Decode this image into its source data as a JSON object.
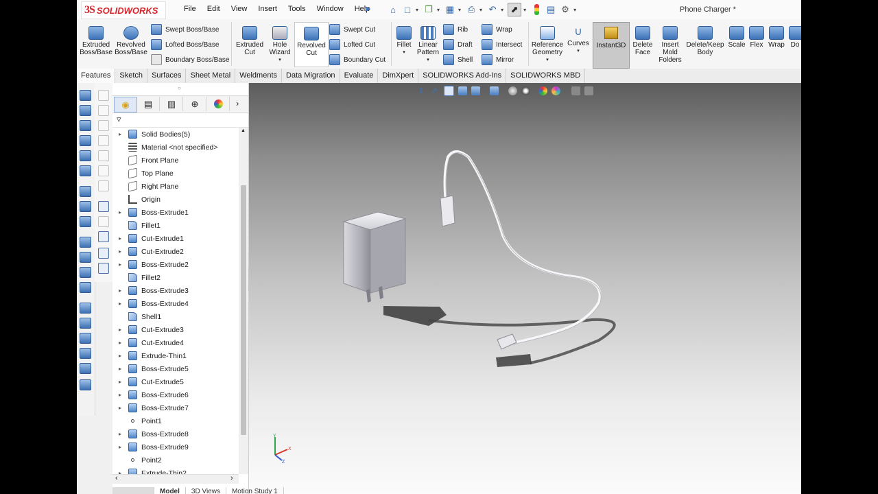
{
  "window": {
    "document_title": "Phone Charger *",
    "brand": "SOLIDWORKS",
    "brand_mark": "3S"
  },
  "menu": [
    "File",
    "Edit",
    "View",
    "Insert",
    "Tools",
    "Window",
    "Help"
  ],
  "quick_access_icons": [
    "home-icon",
    "new-document-icon",
    "open-icon",
    "save-icon",
    "print-icon",
    "undo-icon",
    "select-icon",
    "rebuild-icon",
    "file-properties-icon",
    "options-icon"
  ],
  "commands": {
    "extruded_boss": "Extruded\nBoss/Base",
    "revolved_boss": "Revolved\nBoss/Base",
    "swept_boss": "Swept Boss/Base",
    "lofted_boss": "Lofted Boss/Base",
    "boundary_boss": "Boundary Boss/Base",
    "extruded_cut": "Extruded\nCut",
    "hole_wizard": "Hole\nWizard",
    "revolved_cut": "Revolved\nCut",
    "swept_cut": "Swept Cut",
    "lofted_cut": "Lofted Cut",
    "boundary_cut": "Boundary Cut",
    "fillet": "Fillet",
    "linear_pattern": "Linear\nPattern",
    "rib": "Rib",
    "draft": "Draft",
    "shell": "Shell",
    "wrap": "Wrap",
    "intersect": "Intersect",
    "mirror": "Mirror",
    "reference_geometry": "Reference\nGeometry",
    "curves": "Curves",
    "instant3d": "Instant3D",
    "delete_face": "Delete\nFace",
    "insert_mold_folders": "Insert\nMold\nFolders",
    "delete_keep_body": "Delete/Keep\nBody",
    "scale": "Scale",
    "flex": "Flex",
    "wrap2": "Wrap",
    "do": "Do"
  },
  "tabs": [
    "Features",
    "Sketch",
    "Surfaces",
    "Sheet Metal",
    "Weldments",
    "Data Migration",
    "Evaluate",
    "DimXpert",
    "SOLIDWORKS Add-Ins",
    "SOLIDWORKS MBD"
  ],
  "feature_tree": [
    {
      "label": "Solid Bodies(5)",
      "icon": "solid-bodies",
      "expandable": true
    },
    {
      "label": "Material <not specified>",
      "icon": "material",
      "expandable": false
    },
    {
      "label": "Front Plane",
      "icon": "plane",
      "expandable": false
    },
    {
      "label": "Top Plane",
      "icon": "plane",
      "expandable": false
    },
    {
      "label": "Right Plane",
      "icon": "plane",
      "expandable": false
    },
    {
      "label": "Origin",
      "icon": "origin",
      "expandable": false
    },
    {
      "label": "Boss-Extrude1",
      "icon": "feature",
      "expandable": true
    },
    {
      "label": "Fillet1",
      "icon": "fillet",
      "expandable": false
    },
    {
      "label": "Cut-Extrude1",
      "icon": "feature",
      "expandable": true
    },
    {
      "label": "Cut-Extrude2",
      "icon": "feature",
      "expandable": true
    },
    {
      "label": "Boss-Extrude2",
      "icon": "feature",
      "expandable": true
    },
    {
      "label": "Fillet2",
      "icon": "fillet",
      "expandable": false
    },
    {
      "label": "Boss-Extrude3",
      "icon": "feature",
      "expandable": true
    },
    {
      "label": "Boss-Extrude4",
      "icon": "feature",
      "expandable": true
    },
    {
      "label": "Shell1",
      "icon": "fillet",
      "expandable": false
    },
    {
      "label": "Cut-Extrude3",
      "icon": "feature",
      "expandable": true
    },
    {
      "label": "Cut-Extrude4",
      "icon": "feature",
      "expandable": true
    },
    {
      "label": "Extrude-Thin1",
      "icon": "feature",
      "expandable": true
    },
    {
      "label": "Boss-Extrude5",
      "icon": "feature",
      "expandable": true
    },
    {
      "label": "Cut-Extrude5",
      "icon": "feature",
      "expandable": true
    },
    {
      "label": "Boss-Extrude6",
      "icon": "feature",
      "expandable": true
    },
    {
      "label": "Boss-Extrude7",
      "icon": "feature",
      "expandable": true
    },
    {
      "label": "Point1",
      "icon": "point",
      "expandable": false
    },
    {
      "label": "Boss-Extrude8",
      "icon": "feature",
      "expandable": true
    },
    {
      "label": "Boss-Extrude9",
      "icon": "feature",
      "expandable": true
    },
    {
      "label": "Point2",
      "icon": "point",
      "expandable": false
    },
    {
      "label": "Extrude-Thin2",
      "icon": "feature",
      "expandable": true
    }
  ],
  "bottom_tabs": [
    "Model",
    "3D Views",
    "Motion Study 1"
  ],
  "triad": {
    "x": "X",
    "y": "Y",
    "z": "Z"
  },
  "colors": {
    "brand_red": "#d6262b",
    "accent_blue": "#2e62a8"
  }
}
